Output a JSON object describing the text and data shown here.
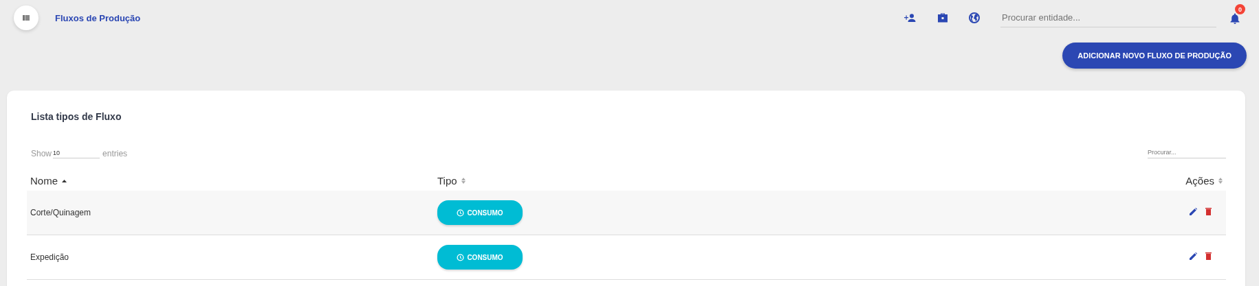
{
  "header": {
    "title": "Fluxos de Produção",
    "search": {
      "placeholder": "Procurar entidade..."
    },
    "notifications": {
      "count": "0"
    }
  },
  "add_button": "ADICIONAR NOVO FLUXO DE PRODUÇÃO",
  "card": {
    "title": "Lista tipos de Fluxo",
    "show_label": "Show",
    "page_size": "10",
    "entries_label": "entries",
    "search": {
      "placeholder": "Procurar..."
    }
  },
  "table": {
    "columns": [
      {
        "label": "Nome",
        "sorted": true
      },
      {
        "label": "Tipo",
        "sorted": false
      },
      {
        "label": "Ações",
        "sorted": false
      }
    ],
    "rows": [
      {
        "name": "Corte/Quinagem",
        "type": "CONSUMO"
      },
      {
        "name": "Expedição",
        "type": "CONSUMO"
      }
    ]
  }
}
